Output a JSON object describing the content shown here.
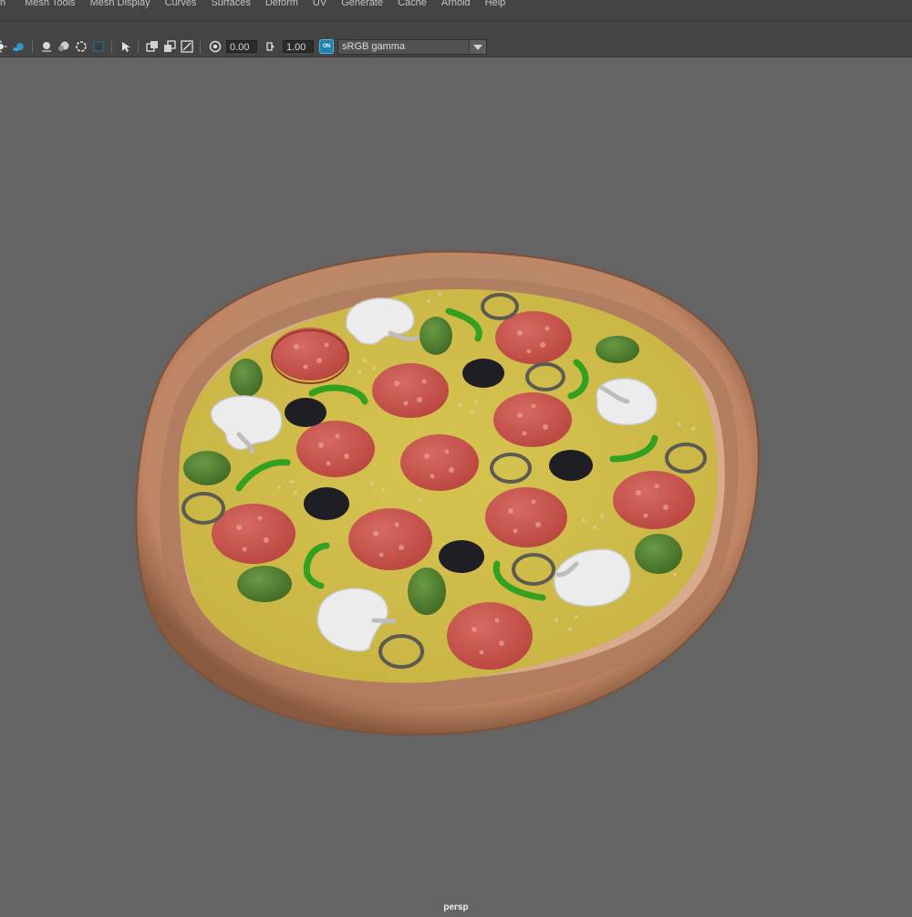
{
  "menubar": {
    "items": [
      "h",
      "Mesh Tools",
      "Mesh Display",
      "Curves",
      "Surfaces",
      "Deform",
      "UV",
      "Generate",
      "Cache",
      "Arnold",
      "Help"
    ]
  },
  "toolbar": {
    "exposure_value": "0.00",
    "gamma_value": "1.00",
    "color_mgmt_toggle_text": "ON",
    "view_transform": "sRGB gamma",
    "icons": [
      "light-icon",
      "shadow-icon",
      "ao-icon",
      "motion-blur-icon",
      "antialias-icon",
      "depth-icon",
      "texture-icon",
      "isolate-select-icon",
      "xray-icon",
      "xray-active-icon",
      "xray-joints-icon",
      "exposure-icon",
      "gamma-icon",
      "color-management-icon"
    ]
  },
  "viewport": {
    "camera_name": "persp",
    "background_color": "#646464",
    "object": "pizza"
  },
  "colors": {
    "panel": "#444444",
    "viewport_bg": "#646464",
    "accent": "#1f7fae"
  }
}
